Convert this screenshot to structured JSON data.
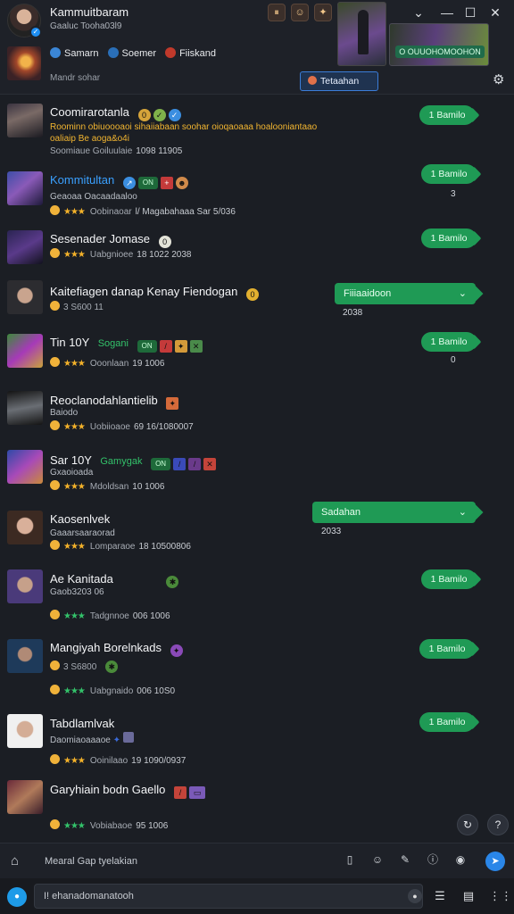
{
  "header": {
    "account_name": "Kammuitbaram",
    "account_sub": "Gaaluc Tooha03l9",
    "network_items": [
      {
        "label": "Samarn",
        "color": "#3b86d6"
      },
      {
        "label": "Soemer",
        "color": "#2a6fb8"
      },
      {
        "label": "Fiiskand",
        "color": "#c0392b"
      }
    ],
    "subheading": "Mandr sohar",
    "translate_label": "Tetaahan",
    "promo_label": "O OUUOHOMOOHON",
    "window_controls": [
      "chevron-down",
      "minimize",
      "maximize",
      "close"
    ]
  },
  "rows": [
    {
      "name": "Coomirarotanla",
      "name_color": "white",
      "line2": "Roominn obiuoooaoi sihaiiabaan soohar oioqaoaaa hoalooniantaao",
      "line2_color": "yellow",
      "line2b": "oaliaip Be aoga&o4i",
      "line3": "Soomiaue Goiluulaie",
      "line3b": "1098 11905",
      "button": "1 Bamilo",
      "button_type": "pill"
    },
    {
      "name": "Kommitultan",
      "name_color": "blue",
      "line2": "Geaoaa Oacaadaaloo",
      "stars": "★★★",
      "line3": "Oobinaoar",
      "line3b": "l/ Magabahaaa Sar 5/036",
      "button": "1 Bamilo",
      "under": "3",
      "button_type": "pill"
    },
    {
      "name": "Sesenader Jomase",
      "name_color": "white",
      "stars": "★★★",
      "line3": "Uabgnioee",
      "line3b": "18 1022 2038",
      "button": "1 Bamilo",
      "button_type": "pill"
    },
    {
      "name": "Kaitefiagen danap Kenay Fiendogan",
      "name_color": "white",
      "coin": "3 S600 11",
      "button": "Fiiiaaidoon",
      "under": "2038",
      "button_type": "wide"
    },
    {
      "name": "Tin 10Y",
      "name_color": "white",
      "extra": "Sogani",
      "stars": "★★★",
      "line3": "Ooonlaan",
      "line3b": "19 1006",
      "button": "1 Bamilo",
      "under": "0",
      "button_type": "pill"
    },
    {
      "name": "Reoclanodahlantielib",
      "name_color": "white",
      "line2": "Baiodo",
      "stars": "★★★",
      "line3": "Uobiioaoe",
      "line3b": "69 16/1080007",
      "button_type": "none"
    },
    {
      "name": "Sar 10Y",
      "name_color": "white",
      "extra": "Gamygak",
      "line2": "Gxaoioada",
      "stars": "★★★",
      "line3": "Mdoldsan",
      "line3b": "10 1006",
      "button_type": "none"
    },
    {
      "name": "Kaosenlvek",
      "name_color": "white",
      "line2": "Gaaarsaaraorad",
      "stars": "★★★",
      "line3": "Lomparaoe",
      "line3b": "18 10500806",
      "button": "Sadahan",
      "under": "2033",
      "button_type": "wide"
    },
    {
      "name": "Ae Kanitada",
      "name_color": "white",
      "line2": "Gaob3203 06",
      "stars": "★★★",
      "stars_color": "green",
      "line3": "Tadgnnoe",
      "line3b": "006 1006",
      "button": "1 Bamilo",
      "button_type": "pill"
    },
    {
      "name": "Mangiyah Borelnkads",
      "name_color": "white",
      "coin": "3 S6800",
      "stars": "★★★",
      "stars_color": "green",
      "line3": "Uabgnaido",
      "line3b": "006 10S0",
      "button": "1 Bamilo",
      "button_type": "pill"
    },
    {
      "name": "Tabdlamlvak",
      "name_color": "white",
      "line2": "Daomiaoaaaoe",
      "stars": "★★★",
      "line3": "Ooinilaao",
      "line3b": "19 1090/0937",
      "button": "1 Bamilo",
      "button_type": "pill"
    },
    {
      "name": "Garyhiain bodn Gaello",
      "name_color": "white",
      "stars": "★★★",
      "stars_color": "green",
      "line3": "Vobiabaoe",
      "line3b": "95 1006",
      "button_type": "none"
    }
  ],
  "composer": {
    "placeholder": "Mearal Gap tyelakian"
  },
  "search": {
    "placeholder": "I! ehanadomanatooh"
  }
}
